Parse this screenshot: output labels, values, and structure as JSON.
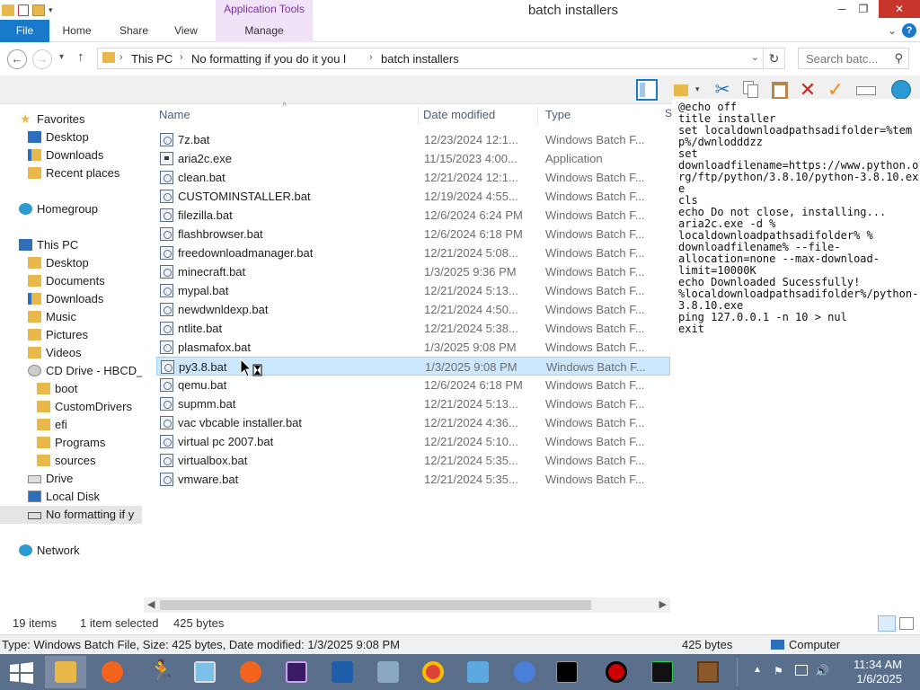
{
  "window": {
    "title": "batch installers",
    "context_tab_group": "Application Tools"
  },
  "ribbon": {
    "tabs": [
      "File",
      "Home",
      "Share",
      "View",
      "Manage"
    ]
  },
  "address": {
    "breadcrumb": [
      "This PC",
      "No formatting if you do it you l",
      "batch installers"
    ],
    "search_placeholder": "Search batc..."
  },
  "navigation": {
    "favorites_label": "Favorites",
    "favorites": [
      "Desktop",
      "Downloads",
      "Recent places"
    ],
    "homegroup_label": "Homegroup",
    "thispc_label": "This PC",
    "thispc": [
      "Desktop",
      "Documents",
      "Downloads",
      "Music",
      "Pictures",
      "Videos"
    ],
    "cd_drive_label": "CD Drive - HBCD_",
    "cd_folders": [
      "boot",
      "CustomDrivers",
      "efi",
      "Programs",
      "sources"
    ],
    "drives": [
      "Drive",
      "Local Disk",
      "No formatting if y"
    ],
    "network_label": "Network"
  },
  "columns": {
    "name": "Name",
    "date": "Date modified",
    "type": "Type"
  },
  "files": [
    {
      "name": "7z.bat",
      "date": "12/23/2024 12:1...",
      "type": "Windows Batch F...",
      "kind": "bat"
    },
    {
      "name": "aria2c.exe",
      "date": "11/15/2023 4:00...",
      "type": "Application",
      "kind": "app"
    },
    {
      "name": "clean.bat",
      "date": "12/21/2024 12:1...",
      "type": "Windows Batch F...",
      "kind": "bat"
    },
    {
      "name": "CUSTOMINSTALLER.bat",
      "date": "12/19/2024 4:55...",
      "type": "Windows Batch F...",
      "kind": "bat"
    },
    {
      "name": "filezilla.bat",
      "date": "12/6/2024 6:24 PM",
      "type": "Windows Batch F...",
      "kind": "bat"
    },
    {
      "name": "flashbrowser.bat",
      "date": "12/6/2024 6:18 PM",
      "type": "Windows Batch F...",
      "kind": "bat"
    },
    {
      "name": "freedownloadmanager.bat",
      "date": "12/21/2024 5:08...",
      "type": "Windows Batch F...",
      "kind": "bat"
    },
    {
      "name": "minecraft.bat",
      "date": "1/3/2025 9:36 PM",
      "type": "Windows Batch F...",
      "kind": "bat"
    },
    {
      "name": "mypal.bat",
      "date": "12/21/2024 5:13...",
      "type": "Windows Batch F...",
      "kind": "bat"
    },
    {
      "name": "newdwnldexp.bat",
      "date": "12/21/2024 4:50...",
      "type": "Windows Batch F...",
      "kind": "bat"
    },
    {
      "name": "ntlite.bat",
      "date": "12/21/2024 5:38...",
      "type": "Windows Batch F...",
      "kind": "bat"
    },
    {
      "name": "plasmafox.bat",
      "date": "1/3/2025 9:08 PM",
      "type": "Windows Batch F...",
      "kind": "bat"
    },
    {
      "name": "py3.8.bat",
      "date": "1/3/2025 9:08 PM",
      "type": "Windows Batch F...",
      "kind": "bat",
      "selected": true
    },
    {
      "name": "qemu.bat",
      "date": "12/6/2024 6:18 PM",
      "type": "Windows Batch F...",
      "kind": "bat"
    },
    {
      "name": "supmm.bat",
      "date": "12/21/2024 5:13...",
      "type": "Windows Batch F...",
      "kind": "bat"
    },
    {
      "name": "vac vbcable installer.bat",
      "date": "12/21/2024 4:36...",
      "type": "Windows Batch F...",
      "kind": "bat"
    },
    {
      "name": "virtual pc 2007.bat",
      "date": "12/21/2024 5:10...",
      "type": "Windows Batch F...",
      "kind": "bat"
    },
    {
      "name": "virtualbox.bat",
      "date": "12/21/2024 5:35...",
      "type": "Windows Batch F...",
      "kind": "bat"
    },
    {
      "name": "vmware.bat",
      "date": "12/21/2024 5:35...",
      "type": "Windows Batch F...",
      "kind": "bat"
    }
  ],
  "preview": {
    "column_letter": "S",
    "text": "@echo off\ntitle installer\nset localdownloadpathsadifolder=%temp%/dwnlodddzz\nset\ndownloadfilename=https://www.python.org/ftp/python/3.8.10/python-3.8.10.exe\ncls\necho Do not close, installing...\naria2c.exe -d %\nlocaldownloadpathsadifolder% %\ndownloadfilename% --file-\nallocation=none --max-download-\nlimit=10000K\necho Downloaded Sucessfully!\n%localdownloadpathsadifolder%/python-3.8.10.exe\nping 127.0.0.1 -n 10 > nul\nexit"
  },
  "status": {
    "item_count": "19 items",
    "selection": "1 item selected",
    "size": "425 bytes"
  },
  "infobar": {
    "details": "Type: Windows Batch File, Size: 425 bytes, Date modified: 1/3/2025 9:08 PM",
    "size": "425 bytes",
    "location": "Computer"
  },
  "clock": {
    "time": "11:34 AM",
    "date": "1/6/2025"
  },
  "colors": {
    "accent": "#1979ca",
    "selection": "#cce8ff",
    "taskbar": "#5a6f8c",
    "close": "#c7352b"
  }
}
